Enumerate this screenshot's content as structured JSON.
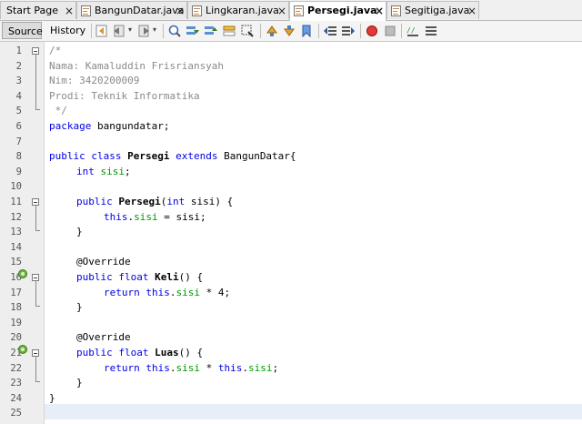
{
  "tabs": [
    {
      "label": "Start Page",
      "close": "×",
      "icon": "",
      "active": false
    },
    {
      "label": "BangunDatar.java",
      "close": "×",
      "icon": "java-file-icon",
      "active": false
    },
    {
      "label": "Lingkaran.java",
      "close": "×",
      "icon": "java-file-icon",
      "active": false
    },
    {
      "label": "Persegi.java",
      "close": "×",
      "icon": "java-file-icon",
      "active": true
    },
    {
      "label": "Segitiga.java",
      "close": "×",
      "icon": "java-file-icon",
      "active": false
    }
  ],
  "toolbar": {
    "source_label": "Source",
    "history_label": "History",
    "icons": [
      "last-edit-icon",
      "back-icon",
      "forward-icon",
      "find-icon",
      "find-previous-icon",
      "find-next-icon",
      "toggle-highlight-icon",
      "find-selection-icon",
      "previous-bookmark-icon",
      "next-bookmark-icon",
      "toggle-bookmark-icon",
      "shift-left-icon",
      "shift-right-icon",
      "start-macro-icon",
      "stop-macro-icon",
      "comment-icon",
      "uncomment-icon"
    ]
  },
  "editor": {
    "line_numbers": [
      "1",
      "2",
      "3",
      "4",
      "5",
      "6",
      "7",
      "8",
      "9",
      "10",
      "11",
      "12",
      "13",
      "14",
      "15",
      "16",
      "17",
      "18",
      "19",
      "20",
      "21",
      "22",
      "23",
      "24",
      "25"
    ],
    "lines": {
      "l1": "/*",
      "l2": "Nama: Kamaluddin Frisriansyah",
      "l3": "Nim: 3420200009",
      "l4": "Prodi: Teknik Informatika",
      "l5": " */",
      "l6_kw": "package",
      "l6_rest": " bangundatar;",
      "l8_kw1": "public class",
      "l8_cls": "Persegi",
      "l8_kw2": "extends",
      "l8_rest": "BangunDatar{",
      "l9_kw": "int",
      "l9_fld": "sisi",
      "l9_rest": ";",
      "l11_kw": "public",
      "l11_name": "Persegi",
      "l11_p1": "(",
      "l11_kw2": "int",
      "l11_rest": " sisi) {",
      "l12_kw": "this",
      "l12_dot": ".",
      "l12_fld": "sisi",
      "l12_rest": " = sisi;",
      "l13": "}",
      "l15": "@Override",
      "l16_kw": "public float",
      "l16_name": "Keli",
      "l16_rest": "() {",
      "l17_kw": "return this",
      "l17_dot": ".",
      "l17_fld": "sisi",
      "l17_rest": " * 4;",
      "l18": "}",
      "l20": "@Override",
      "l21_kw": "public float",
      "l21_name": "Luas",
      "l21_rest": "() {",
      "l22_kw": "return this",
      "l22_dot": ".",
      "l22_fld": "sisi",
      "l22_mid": " * ",
      "l22_kw2": "this",
      "l22_dot2": ".",
      "l22_fld2": "sisi",
      "l22_rest": ";",
      "l23": "}",
      "l24": "}"
    }
  },
  "colors": {
    "keyword": "#0000e6",
    "comment": "#8a8a8a",
    "field": "#009900",
    "current_line": "#e8eef8"
  }
}
